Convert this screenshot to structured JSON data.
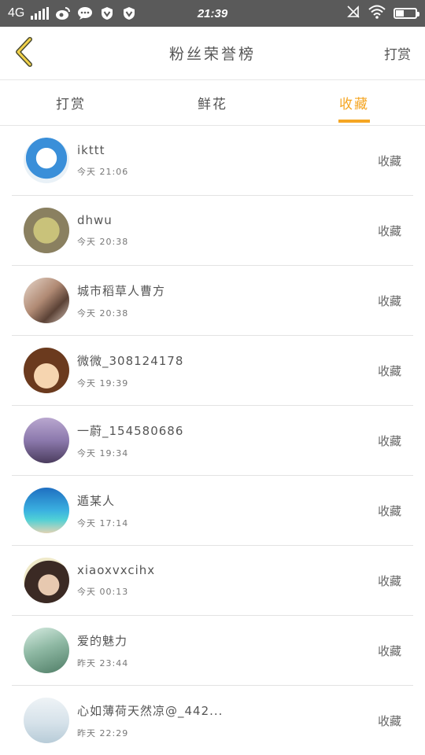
{
  "status_bar": {
    "network": "4G",
    "time": "21:39",
    "app_icons": [
      "weibo-icon",
      "message-bubble-icon",
      "shield-v-icon",
      "shield-v-icon"
    ]
  },
  "header": {
    "title": "粉丝荣誉榜",
    "right_action": "打赏"
  },
  "tabs": [
    {
      "label": "打赏",
      "active": false
    },
    {
      "label": "鲜花",
      "active": false
    },
    {
      "label": "收藏",
      "active": true
    }
  ],
  "colors": {
    "accent": "#f5a623",
    "statusbar": "#5a5a5a"
  },
  "rows": [
    {
      "name": "ikttt",
      "time": "今天 21:06",
      "action": "收藏"
    },
    {
      "name": "dhwu",
      "time": "今天 20:38",
      "action": "收藏"
    },
    {
      "name": "城市稻草人曹方",
      "time": "今天 20:38",
      "action": "收藏"
    },
    {
      "name": "微微_308124178",
      "time": "今天 19:39",
      "action": "收藏"
    },
    {
      "name": "一蔚_154580686",
      "time": "今天 19:34",
      "action": "收藏"
    },
    {
      "name": "遁某人",
      "time": "今天 17:14",
      "action": "收藏"
    },
    {
      "name": "xiaoxvxcihx",
      "time": "今天 00:13",
      "action": "收藏"
    },
    {
      "name": "爱的魅力",
      "time": "昨天 23:44",
      "action": "收藏"
    },
    {
      "name": "心如薄荷天然凉@_442...",
      "time": "昨天 22:29",
      "action": "收藏"
    }
  ]
}
